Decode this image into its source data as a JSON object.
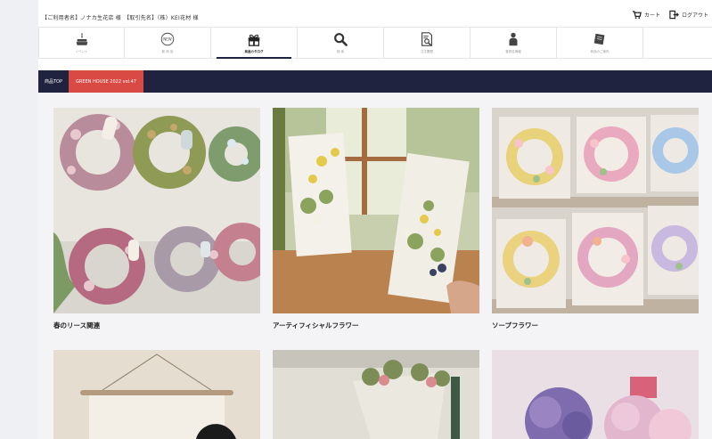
{
  "header": {
    "customer_info": "【ご利用者名】ノナカ生花店 様　【取引先名】（株）KEI花材 様",
    "cart_label": "カート",
    "logout_label": "ログアウト"
  },
  "nav": {
    "items": [
      {
        "label": "イベント",
        "icon": "cake-icon"
      },
      {
        "label": "新 商 品",
        "icon": "new-badge-icon"
      },
      {
        "label": "商品カタログ",
        "icon": "gift-box-icon",
        "active": true
      },
      {
        "label": "検 索",
        "icon": "search-icon"
      },
      {
        "label": "注文履歴",
        "icon": "order-history-icon"
      },
      {
        "label": "登録名情報",
        "icon": "user-icon"
      },
      {
        "label": "商品のご案内",
        "icon": "catalog-book-icon"
      }
    ]
  },
  "breadcrumb": {
    "home": "商品TOP",
    "current": "GREEN HOUSE 2022 vol.47"
  },
  "products": [
    {
      "title": "春のリース関連"
    },
    {
      "title": "アーティフィシャルフラワー"
    },
    {
      "title": "ソープフラワー"
    }
  ],
  "colors": {
    "navy": "#1f2340",
    "accent_red": "#d94a44"
  }
}
